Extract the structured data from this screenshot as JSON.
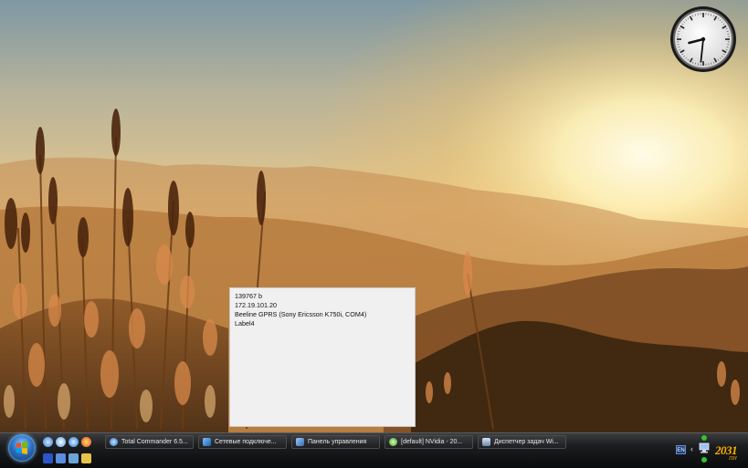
{
  "info_window": {
    "lines": [
      "139767 b",
      "172.19.101.20",
      "Beeline GPRS (Sony Ericsson K750i, COM4)",
      "Label4"
    ]
  },
  "taskbar": {
    "buttons": [
      {
        "label": "Total Commander 6.5...",
        "icon": "total-commander-icon"
      },
      {
        "label": "Сетевые подключе...",
        "icon": "network-connections-icon"
      },
      {
        "label": "Панель управления",
        "icon": "control-panel-icon"
      },
      {
        "label": "[default] NVidia - 20...",
        "icon": "nvidia-icon"
      },
      {
        "label": "Диспетчер задач Wi...",
        "icon": "task-manager-icon"
      }
    ],
    "quick_launch": [
      "show-desktop-icon",
      "browser-icon",
      "ie-icon",
      "firefox-icon",
      "app-icon",
      "window-switch-icon",
      "folder-icon",
      "explorer-icon"
    ],
    "tray": {
      "language": "EN",
      "time": "2031",
      "time_suffix": "ПН"
    }
  },
  "clock": {
    "hour": 8,
    "minute": 31
  },
  "colors": {
    "taskbar": "#0a0b0c",
    "accent_time": "#ffb000",
    "window_bg": "#f0f0f0"
  }
}
